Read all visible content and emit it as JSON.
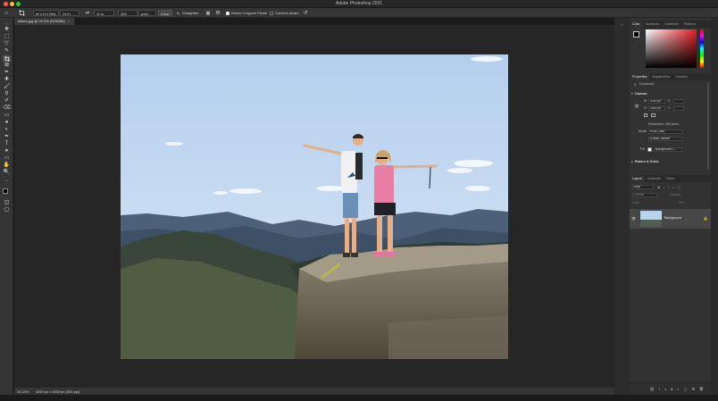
{
  "app": {
    "title": "Adobe Photoshop 2021"
  },
  "colors": {
    "accent": "#1473e6",
    "workspace": "#262626",
    "panel": "#323232"
  },
  "options_bar": {
    "ratio_value": "W x H x Res...",
    "width_value": "14 in",
    "height_value": "11 in",
    "resolution_value": "300",
    "resolution_unit": "px/in",
    "clear_label": "Clear",
    "straighten_label": "Straighten",
    "delete_cropped_label": "Delete Cropped Pixels",
    "content_aware_label": "Content-Aware",
    "tool_icon": "crop-icon"
  },
  "document": {
    "tab_label": "hikers.jpg @ 33.3% (RGB/8#)",
    "close_glyph": "×"
  },
  "status": {
    "zoom": "33.33%",
    "doc_info": "4200 px x 3300 px (300 ppi)"
  },
  "color_panel": {
    "tabs": [
      "Color",
      "Swatches",
      "Gradients",
      "Patterns"
    ]
  },
  "properties_panel": {
    "tabs": [
      "Properties",
      "Adjustments",
      "Libraries"
    ],
    "document_label": "Document",
    "canvas_heading": "Canvas",
    "w_label": "W",
    "width_value": "4200 px",
    "x_label": "X",
    "h_label": "H",
    "height_value": "3300 px",
    "y_label": "Y",
    "resolution_text": "Resolution: 300 pixel...",
    "mode_label": "Mode",
    "mode_value": "RGB Color",
    "bits_value": "8 Bits/Channel",
    "fill_label": "Fill",
    "fill_value": "Background C...",
    "rulers_heading": "Rulers & Grids"
  },
  "layers_panel": {
    "tabs": [
      "Layers",
      "Channels",
      "Paths"
    ],
    "kind_placeholder": "Kind",
    "blend_mode": "Normal",
    "opacity_label": "Opacity:",
    "lock_label": "Lock:",
    "fill_label": "Fill:",
    "layer_name": "Background"
  }
}
